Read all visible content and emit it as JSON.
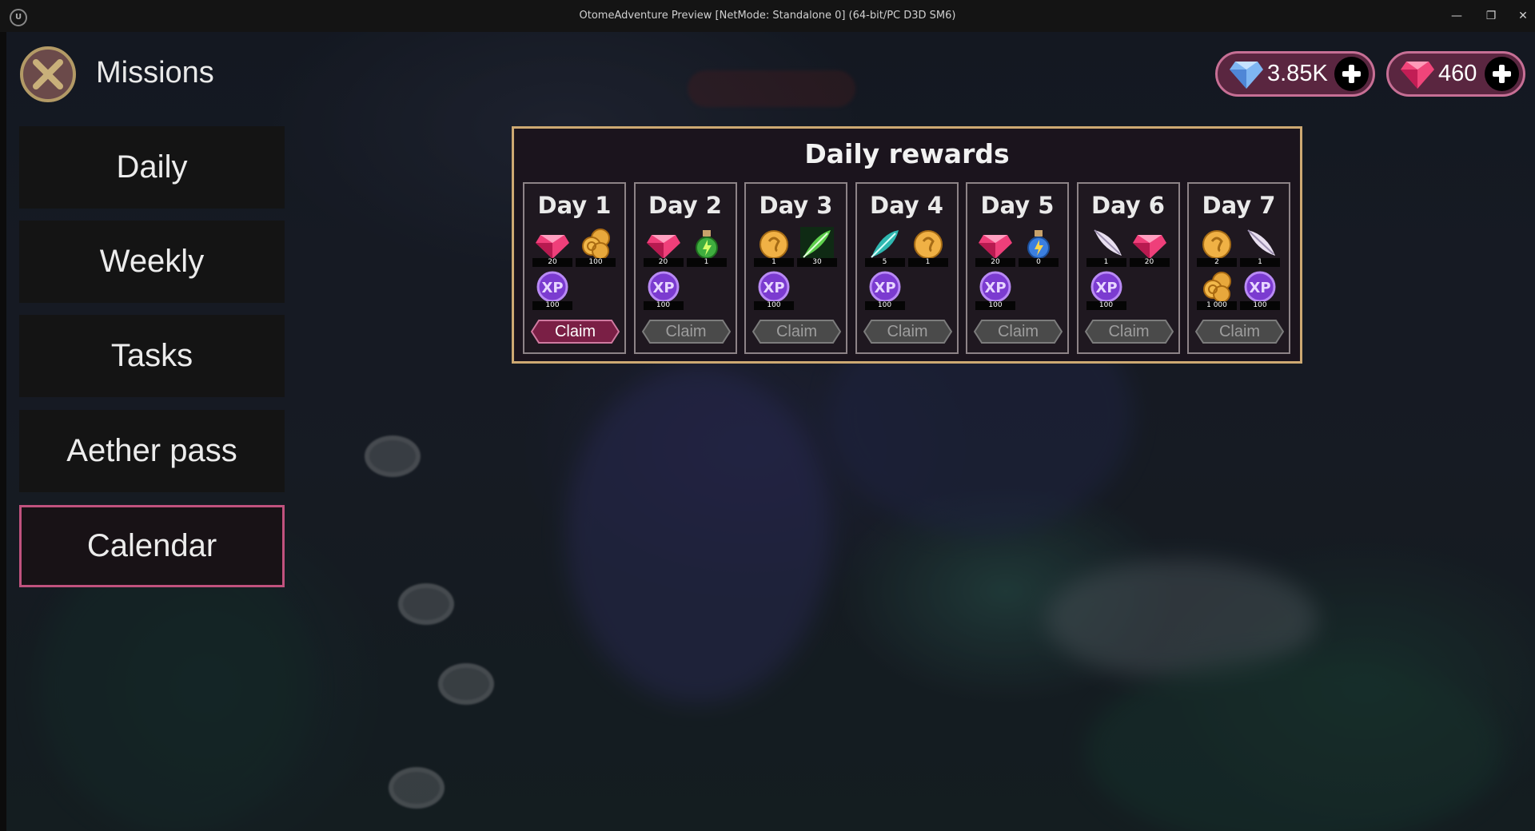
{
  "window": {
    "title": "OtomeAdventure Preview [NetMode: Standalone 0]  (64-bit/PC D3D SM6)",
    "logo_text": "U",
    "minimize_glyph": "—",
    "maximize_glyph": "❐",
    "close_glyph": "✕"
  },
  "header": {
    "title": "Missions"
  },
  "menu": {
    "items": [
      {
        "label": "Daily",
        "active": false
      },
      {
        "label": "Weekly",
        "active": false
      },
      {
        "label": "Tasks",
        "active": false
      },
      {
        "label": "Aether pass",
        "active": false
      },
      {
        "label": "Calendar",
        "active": true
      }
    ]
  },
  "currency": {
    "blue_gems": "3.85K",
    "red_gems": "460",
    "accent": "#c76f95"
  },
  "rewards": {
    "title": "Daily rewards",
    "claim_label": "Claim",
    "days": [
      {
        "label": "Day 1",
        "claimable": true,
        "items": [
          {
            "icon": "red-gem-icon",
            "qty": "20"
          },
          {
            "icon": "coins-icon",
            "qty": "100"
          },
          {
            "icon": "xp-orb-icon",
            "qty": "100"
          }
        ]
      },
      {
        "label": "Day 2",
        "claimable": false,
        "items": [
          {
            "icon": "red-gem-icon",
            "qty": "20"
          },
          {
            "icon": "green-potion-icon",
            "qty": "1"
          },
          {
            "icon": "xp-orb-icon",
            "qty": "100"
          }
        ]
      },
      {
        "label": "Day 3",
        "claimable": false,
        "items": [
          {
            "icon": "gold-coin-icon",
            "qty": "1"
          },
          {
            "icon": "green-feather-icon",
            "qty": "30"
          },
          {
            "icon": "xp-orb-icon",
            "qty": "100"
          }
        ]
      },
      {
        "label": "Day 4",
        "claimable": false,
        "items": [
          {
            "icon": "teal-feather-icon",
            "qty": "5"
          },
          {
            "icon": "gold-coin-icon",
            "qty": "1"
          },
          {
            "icon": "xp-orb-icon",
            "qty": "100"
          }
        ]
      },
      {
        "label": "Day 5",
        "claimable": false,
        "items": [
          {
            "icon": "red-gem-icon",
            "qty": "20"
          },
          {
            "icon": "blue-potion-icon",
            "qty": "0"
          },
          {
            "icon": "xp-orb-icon",
            "qty": "100"
          }
        ]
      },
      {
        "label": "Day 6",
        "claimable": false,
        "items": [
          {
            "icon": "white-feather-icon",
            "qty": "1"
          },
          {
            "icon": "red-gem-icon",
            "qty": "20"
          },
          {
            "icon": "xp-orb-icon",
            "qty": "100"
          }
        ]
      },
      {
        "label": "Day 7",
        "claimable": false,
        "items": [
          {
            "icon": "gold-coin-icon",
            "qty": "2"
          },
          {
            "icon": "white-feather-icon",
            "qty": "1"
          },
          {
            "icon": "coins-icon",
            "qty": "1 000"
          },
          {
            "icon": "xp-orb-icon",
            "qty": "100"
          }
        ]
      }
    ]
  }
}
